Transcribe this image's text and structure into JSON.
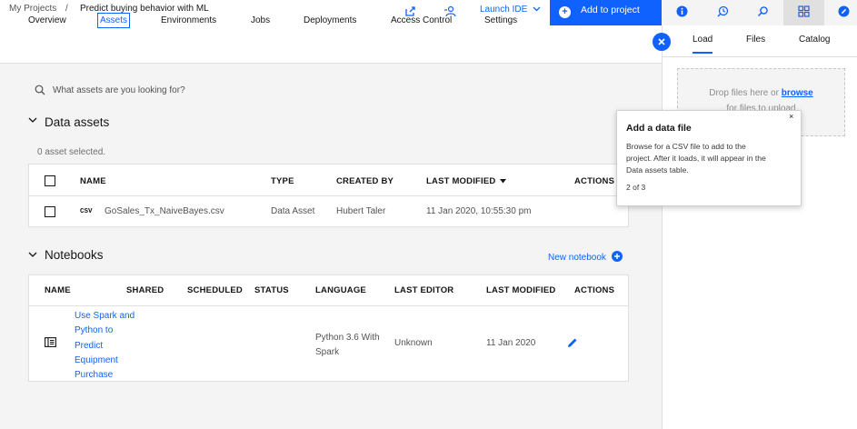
{
  "breadcrumb": {
    "root": "My Projects",
    "separator": "/",
    "current": "Predict buying behavior with ML"
  },
  "header": {
    "launch_ide": "Launch IDE",
    "add_to_project": "Add to project"
  },
  "tabs": [
    "Overview",
    "Assets",
    "Environments",
    "Jobs",
    "Deployments",
    "Access Control",
    "Settings"
  ],
  "active_tab": "Assets",
  "search": {
    "placeholder": "What assets are you looking for?"
  },
  "data_assets": {
    "title": "Data assets",
    "selected_count": "0 asset selected.",
    "columns": [
      "NAME",
      "TYPE",
      "CREATED BY",
      "LAST MODIFIED",
      "ACTIONS"
    ],
    "rows": [
      {
        "badge": "CSV",
        "name": "GoSales_Tx_NaiveBayes.csv",
        "type": "Data Asset",
        "created_by": "Hubert Taler",
        "last_modified": "11 Jan 2020, 10:55:30 pm"
      }
    ]
  },
  "notebooks": {
    "title": "Notebooks",
    "new_notebook": "New notebook",
    "columns": [
      "NAME",
      "SHARED",
      "SCHEDULED",
      "STATUS",
      "LANGUAGE",
      "LAST EDITOR",
      "LAST MODIFIED",
      "ACTIONS"
    ],
    "rows": [
      {
        "name_lines": [
          "Use Spark and",
          "Python to",
          "Predict",
          "Equipment",
          "Purchase"
        ],
        "language_lines": [
          "Python 3.6 With",
          "Spark"
        ],
        "last_editor": "Unknown",
        "last_modified": "11 Jan 2020"
      }
    ]
  },
  "right_panel": {
    "tabs": [
      "Load",
      "Files",
      "Catalog"
    ],
    "active_tab": "Load",
    "drop_text": "Drop files here or",
    "browse": "browse",
    "drop_text_2": "for files to upload"
  },
  "tooltip": {
    "title": "Add a data file",
    "body_lines": [
      "Browse for a CSV file to add to the",
      "project. After it loads, it will appear in the",
      "Data assets table."
    ],
    "step": "2 of 3",
    "close": "×"
  },
  "colors": {
    "accent": "#0f62fe",
    "background": "#f4f4f4",
    "surface": "#ffffff"
  }
}
